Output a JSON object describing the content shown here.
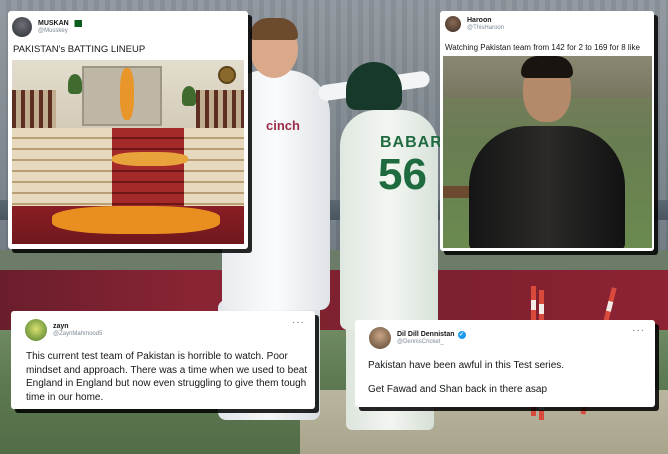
{
  "background": {
    "england_sponsor": "cinch",
    "pakistan_player_name": "BABAR",
    "pakistan_player_number": "56"
  },
  "tweets": [
    {
      "name": "MUSKAN",
      "handle": "@Musskey",
      "text": "PAKISTAN's BATTING LINEUP"
    },
    {
      "name": "Haroon",
      "handle": "@ThisHaroon",
      "text": "Watching Pakistan team from 142 for 2 to 169 for 8 like"
    },
    {
      "name": "zayn",
      "handle": "@ZaynMahmood5",
      "text": "This current test team of Pakistan is horrible to watch. Poor mindset and approach. There was a time when we used to beat England in England but now even struggling to give them tough time in our home.",
      "more": "···"
    },
    {
      "name": "Dil Dill Dennistan",
      "handle": "@DennisCricket_",
      "text_line1": "Pakistan have been awful in this Test series.",
      "text_line2": "Get Fawad and Shan back in there asap",
      "more": "···"
    }
  ],
  "colors": {
    "pakistan_green": "#1e6b3f",
    "verified_blue": "#1d9bf0",
    "stump_red": "#d94a3c"
  }
}
